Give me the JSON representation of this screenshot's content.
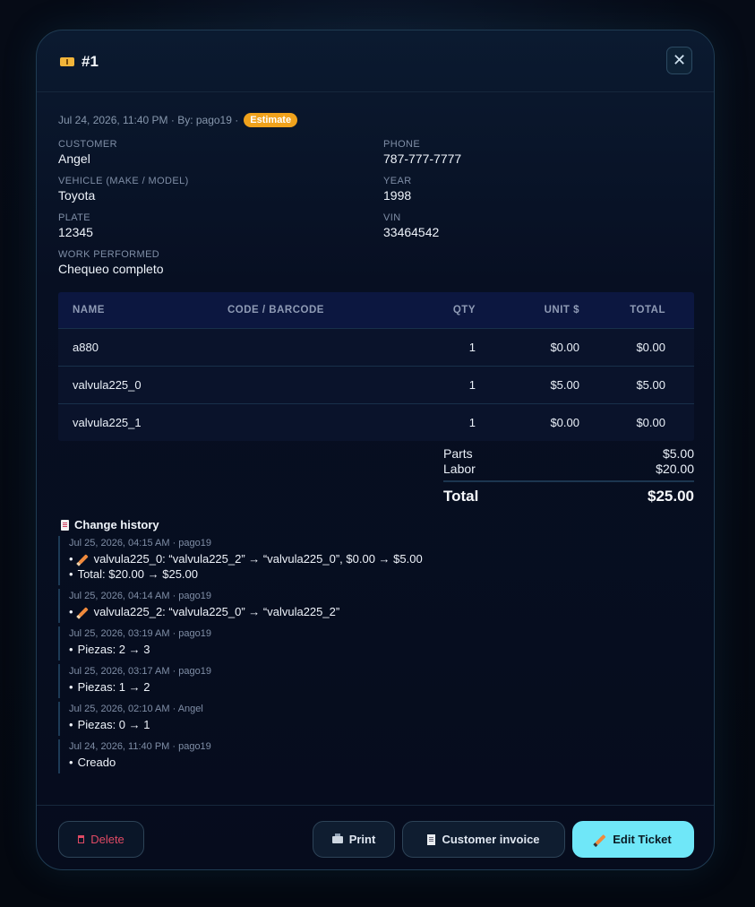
{
  "header": {
    "title": "#1",
    "title_icon": "ticket-icon",
    "close_icon": "close-icon",
    "close_symbol": "✕"
  },
  "meta": {
    "text": "Jul 24, 2026, 11:40 PM · By: pago19 ·",
    "status_badge": "Estimate",
    "badge_color": "#f0a21c"
  },
  "fields": {
    "customer": {
      "label": "CUSTOMER",
      "value": "Angel"
    },
    "phone": {
      "label": "PHONE",
      "value": "787-777-7777"
    },
    "vehicle": {
      "label": "VEHICLE (MAKE / MODEL)",
      "value": "Toyota"
    },
    "year": {
      "label": "YEAR",
      "value": "1998"
    },
    "plate": {
      "label": "PLATE",
      "value": "12345"
    },
    "vin": {
      "label": "VIN",
      "value": "33464542"
    },
    "work": {
      "label": "WORK PERFORMED",
      "value": "Chequeo completo"
    }
  },
  "table": {
    "headers": [
      "NAME",
      "CODE / BARCODE",
      "QTY",
      "UNIT $",
      "TOTAL"
    ],
    "rows": [
      {
        "name": "a880",
        "code": "",
        "qty": "1",
        "unit": "$0.00",
        "total": "$0.00"
      },
      {
        "name": "valvula225_0",
        "code": "",
        "qty": "1",
        "unit": "$5.00",
        "total": "$5.00"
      },
      {
        "name": "valvula225_1",
        "code": "",
        "qty": "1",
        "unit": "$0.00",
        "total": "$0.00"
      }
    ]
  },
  "summary": {
    "parts_label": "Parts",
    "parts_value": "$5.00",
    "labor_label": "Labor",
    "labor_value": "$20.00",
    "total_label": "Total",
    "total_value": "$25.00"
  },
  "history": {
    "title": "Change history",
    "entries": [
      {
        "meta": "Jul 25, 2026, 04:15 AM · pago19",
        "lines": [
          {
            "bullet": "•",
            "edit": true,
            "text": "valvula225_0: “valvula225_2” → “valvula225_0”, $0.00 → $5.00"
          },
          {
            "bullet": "•",
            "edit": false,
            "text": "Total: $20.00 → $25.00"
          }
        ]
      },
      {
        "meta": "Jul 25, 2026, 04:14 AM · pago19",
        "lines": [
          {
            "bullet": "•",
            "edit": true,
            "text": "valvula225_2: “valvula225_0” → “valvula225_2”"
          }
        ]
      },
      {
        "meta": "Jul 25, 2026, 03:19 AM · pago19",
        "lines": [
          {
            "bullet": "•",
            "edit": false,
            "text": "Piezas: 2 → 3"
          }
        ]
      },
      {
        "meta": "Jul 25, 2026, 03:17 AM · pago19",
        "lines": [
          {
            "bullet": "•",
            "edit": false,
            "text": "Piezas: 1 → 2"
          }
        ]
      },
      {
        "meta": "Jul 25, 2026, 02:10 AM · Angel",
        "lines": [
          {
            "bullet": "•",
            "edit": false,
            "text": "Piezas: 0 → 1"
          }
        ]
      },
      {
        "meta": "Jul 24, 2026, 11:40 PM · pago19",
        "lines": [
          {
            "bullet": "•",
            "edit": false,
            "text": "Creado"
          }
        ]
      }
    ]
  },
  "footer": {
    "delete_label": "Delete",
    "print_label": "Print",
    "invoice_label": "Customer invoice",
    "edit_label": "Edit Ticket",
    "accent_color": "#6fe7f8",
    "danger_color": "#e04a64"
  }
}
